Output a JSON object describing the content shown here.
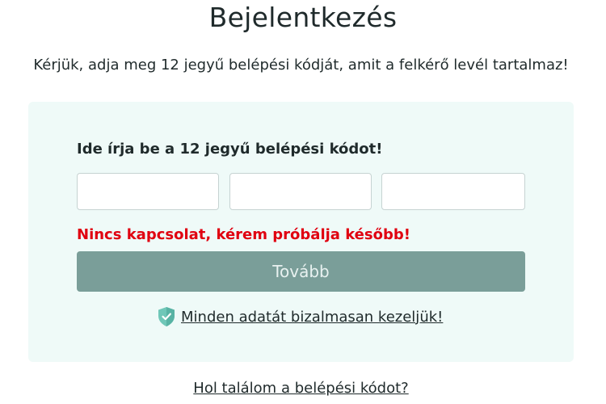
{
  "page": {
    "title": "Bejelentkezés",
    "subtitle": "Kérjük, adja meg 12 jegyű belépési kódját, amit a felkérő levél tartalmaz!"
  },
  "login_card": {
    "field_label": "Ide írja be a 12 jegyű belépési kódot!",
    "code_inputs": [
      {
        "value": "",
        "placeholder": ""
      },
      {
        "value": "",
        "placeholder": ""
      },
      {
        "value": "",
        "placeholder": ""
      }
    ],
    "error_message": "Nincs kapcsolat, kérem próbálja később!",
    "next_button_label": "Tovább",
    "trust_icon": "shield-check-icon",
    "trust_link_text": " Minden adatát bizalmasan kezeljük!"
  },
  "footer": {
    "help_link_text": "Hol találom a belépési kódot?"
  },
  "colors": {
    "card_background": "#effaf8",
    "button_background": "#7a9e99",
    "error": "#e00010",
    "shield": "#6fc7b8"
  }
}
